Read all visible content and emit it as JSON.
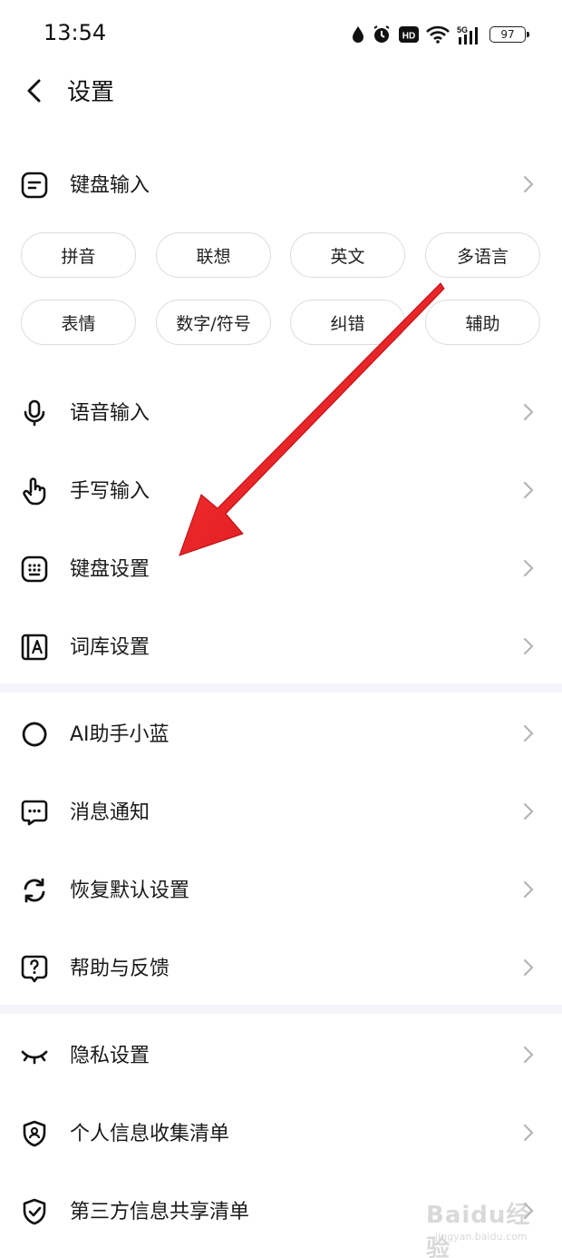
{
  "status_bar": {
    "time": "13:54",
    "network": "5G",
    "hd": "HD",
    "battery": "97"
  },
  "header": {
    "title": "设置"
  },
  "keyboard_input": {
    "label": "键盘输入",
    "chips": [
      "拼音",
      "联想",
      "英文",
      "多语言",
      "表情",
      "数字/符号",
      "纠错",
      "辅助"
    ]
  },
  "section1": [
    {
      "label": "语音输入",
      "icon": "microphone-icon"
    },
    {
      "label": "手写输入",
      "icon": "hand-pointer-icon"
    },
    {
      "label": "键盘设置",
      "icon": "keyboard-icon"
    },
    {
      "label": "词库设置",
      "icon": "dictionary-icon"
    }
  ],
  "section2": [
    {
      "label": "AI助手小蓝",
      "icon": "ai-assistant-icon"
    },
    {
      "label": "消息通知",
      "icon": "message-icon"
    },
    {
      "label": "恢复默认设置",
      "icon": "refresh-icon"
    },
    {
      "label": "帮助与反馈",
      "icon": "help-icon"
    }
  ],
  "section3": [
    {
      "label": "隐私设置",
      "icon": "closed-eye-icon"
    },
    {
      "label": "个人信息收集清单",
      "icon": "shield-user-icon"
    },
    {
      "label": "第三方信息共享清单",
      "icon": "shield-check-icon"
    }
  ],
  "watermark": {
    "brand": "Baidu经验",
    "url": "jingyan.baidu.com"
  },
  "colors": {
    "annotation_arrow": "#e5161c",
    "divider": "#f3f5f9",
    "chip_border": "#dcdcdc"
  }
}
